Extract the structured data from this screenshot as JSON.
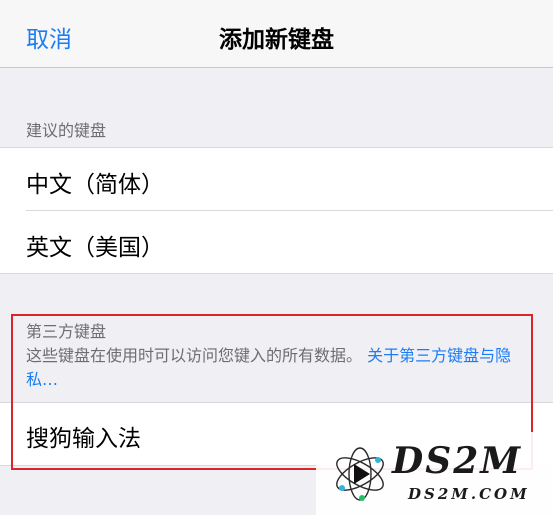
{
  "navbar": {
    "cancel_label": "取消",
    "title": "添加新键盘"
  },
  "suggested": {
    "header": "建议的键盘",
    "items": [
      "中文（简体）",
      "英文（美国）"
    ]
  },
  "third_party": {
    "header": "第三方键盘",
    "description": "这些键盘在使用时可以访问您键入的所有数据。",
    "link_label": "关于第三方键盘与隐私…",
    "items": [
      "搜狗输入法"
    ]
  },
  "watermark": {
    "title": "DS2M",
    "subtitle": "DS2M.COM"
  },
  "colors": {
    "accent": "#1b7cf4",
    "highlight": "#d9262b",
    "background": "#efeff4"
  }
}
